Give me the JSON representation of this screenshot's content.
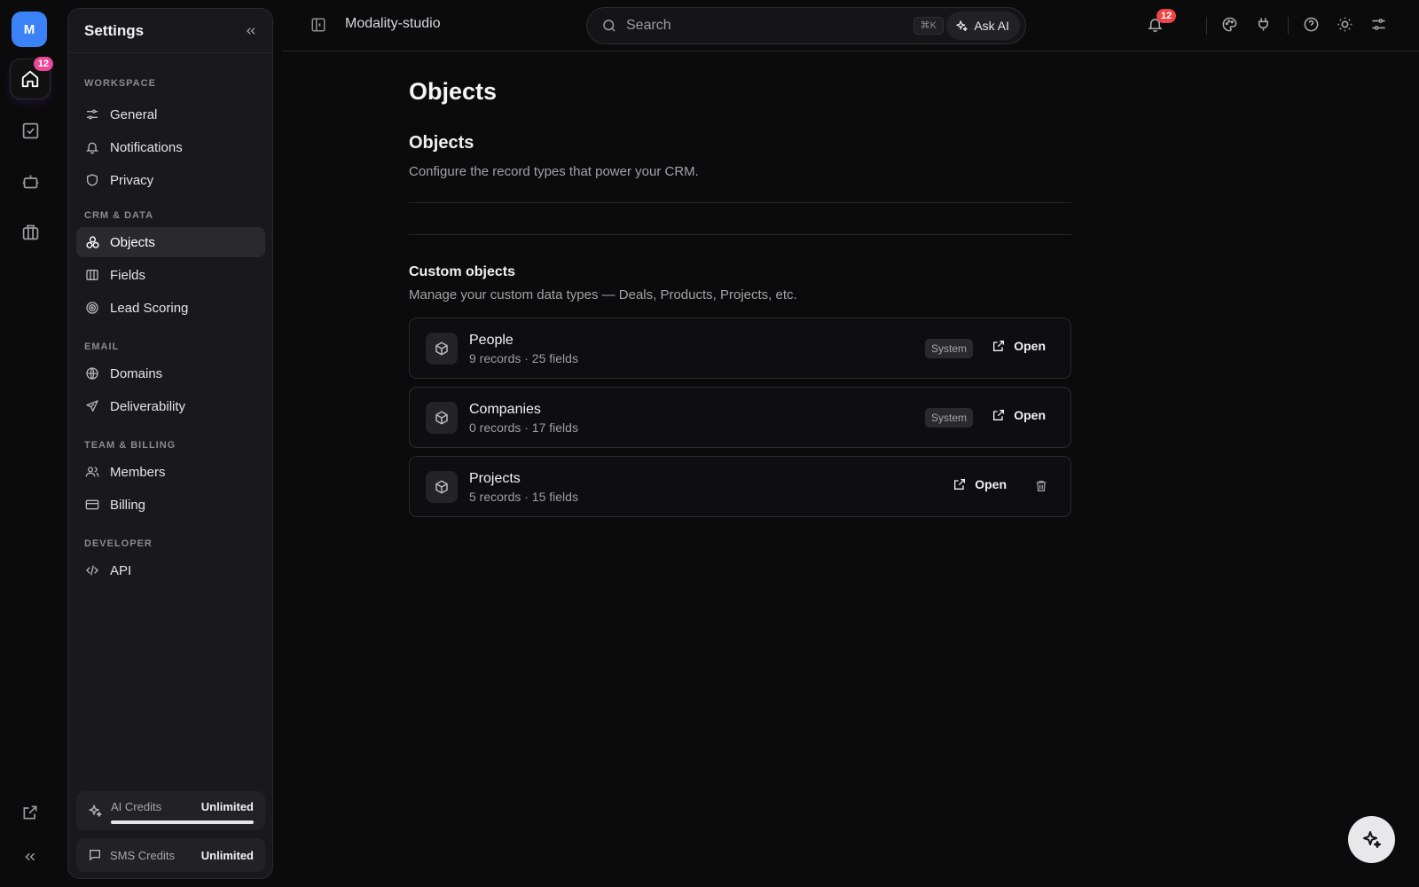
{
  "rail": {
    "workspace_initial": "M",
    "home_badge": "12",
    "icons": [
      "home-icon",
      "checklist-icon",
      "robot-icon",
      "briefcase-icon",
      "external-link-icon",
      "chevrons-left-icon"
    ]
  },
  "settings": {
    "title": "Settings",
    "sections": [
      {
        "label": "WORKSPACE",
        "items": [
          {
            "label": "General",
            "icon": "sliders-icon"
          },
          {
            "label": "Notifications",
            "icon": "bell-icon"
          },
          {
            "label": "Privacy",
            "icon": "shield-icon"
          }
        ]
      },
      {
        "label": "CRM & DATA",
        "items": [
          {
            "label": "Objects",
            "icon": "objects-icon"
          },
          {
            "label": "Fields",
            "icon": "columns-icon"
          },
          {
            "label": "Lead Scoring",
            "icon": "target-icon"
          }
        ]
      },
      {
        "label": "EMAIL",
        "items": [
          {
            "label": "Domains",
            "icon": "globe-icon"
          },
          {
            "label": "Deliverability",
            "icon": "send-icon"
          }
        ]
      },
      {
        "label": "TEAM & BILLING",
        "items": [
          {
            "label": "Members",
            "icon": "users-icon"
          },
          {
            "label": "Billing",
            "icon": "card-icon"
          }
        ]
      },
      {
        "label": "DEVELOPER",
        "items": [
          {
            "label": "API",
            "icon": "code-icon"
          }
        ]
      }
    ],
    "active_item": "Objects",
    "credits": {
      "ai_label": "AI Credits",
      "ai_value": "Unlimited",
      "ai_progress": 1.0,
      "sms_label": "SMS Credits",
      "sms_value": "Unlimited"
    }
  },
  "topbar": {
    "workspace_name": "Modality-studio",
    "search_placeholder": "Search",
    "shortcut": "⌘K",
    "ask_ai": "Ask AI",
    "notifications_badge": "12"
  },
  "main": {
    "page_title": "Objects",
    "section_title": "Objects",
    "section_subtitle": "Configure the record types that power your CRM.",
    "custom_title": "Custom objects",
    "custom_subtitle": "Manage your custom data types — Deals, Products, Projects, etc.",
    "objects": [
      {
        "name": "People",
        "meta": "9 records · 25 fields",
        "badge": "System",
        "action": "Open"
      },
      {
        "name": "Companies",
        "meta": "0 records · 17 fields",
        "badge": "System",
        "action": "Open"
      },
      {
        "name": "Projects",
        "meta": "5 records · 15 fields",
        "badge": "",
        "action": "Open"
      }
    ]
  },
  "colors": {
    "accent": "#3b82f6",
    "badge_pink": "#ec4899",
    "badge_red": "#ef4444",
    "bg": "#0b0b0c",
    "panel": "#19191b"
  }
}
